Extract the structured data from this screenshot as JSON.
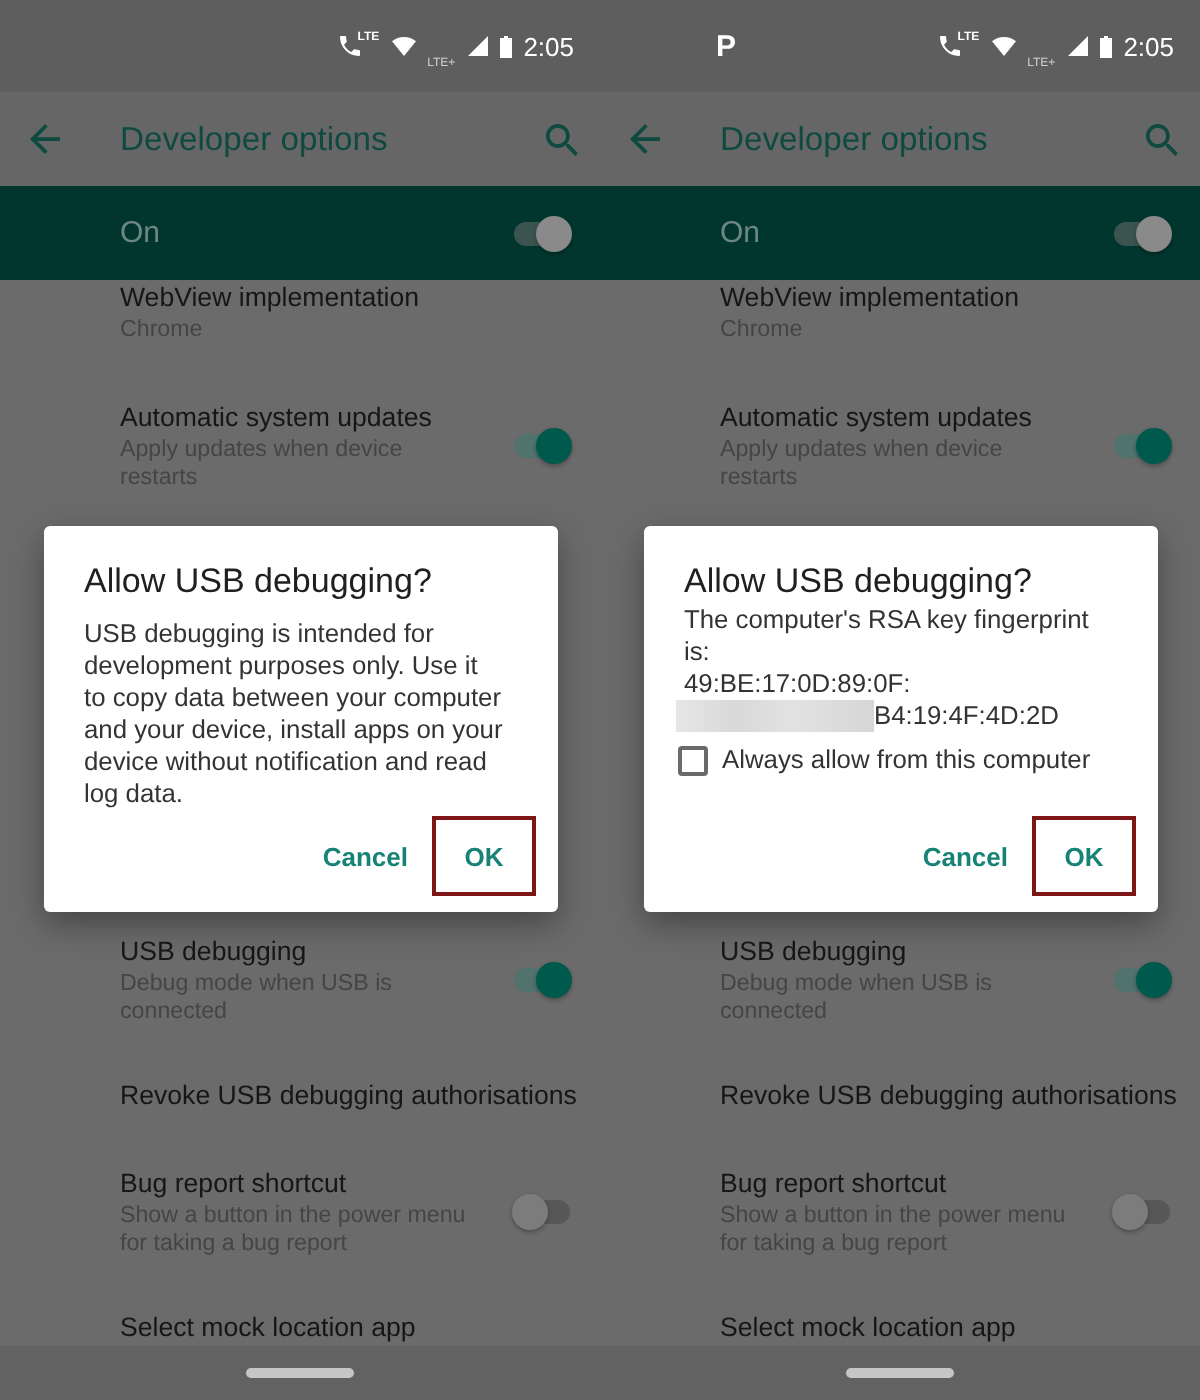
{
  "screens": [
    {
      "status_bar": {
        "volte_label": "LTE",
        "network_label": "LTE+",
        "time": "2:05"
      },
      "app_bar": {
        "title": "Developer options"
      },
      "master_switch": {
        "label": "On",
        "on": true
      },
      "settings_above": [
        {
          "kind": "text",
          "title": "WebView implementation",
          "summary": "Chrome"
        },
        {
          "kind": "switch",
          "title": "Automatic system updates",
          "summary": "Apply updates when device restarts",
          "on": true
        }
      ],
      "dialog": {
        "title": "Allow USB debugging?",
        "message": "USB debugging is intended for\ndevelopment purposes only. Use it\nto copy data between your computer\nand your device, install apps on your\ndevice without notification and read\nlog data.",
        "buttons": [
          {
            "label": "Cancel",
            "highlighted": false
          },
          {
            "label": "OK",
            "highlighted": true
          }
        ]
      },
      "settings_below": [
        {
          "kind": "switch",
          "title": "USB debugging",
          "summary": "Debug mode when USB is connected",
          "on": true
        },
        {
          "kind": "text",
          "title": "Revoke USB debugging authorisations"
        },
        {
          "kind": "switch",
          "title": "Bug report shortcut",
          "summary": "Show a button in the power menu for taking a bug report",
          "on": false
        },
        {
          "kind": "text",
          "title": "Select mock location app"
        }
      ]
    },
    {
      "status_bar": {
        "notification_icons": [
          "P"
        ],
        "volte_label": "LTE",
        "network_label": "LTE+",
        "time": "2:05"
      },
      "app_bar": {
        "title": "Developer options"
      },
      "master_switch": {
        "label": "On",
        "on": true
      },
      "settings_above": [
        {
          "kind": "text",
          "title": "WebView implementation",
          "summary": "Chrome"
        },
        {
          "kind": "switch",
          "title": "Automatic system updates",
          "summary": "Apply updates when device restarts",
          "on": true
        }
      ],
      "dialog": {
        "title": "Allow USB debugging?",
        "message": "The computer's RSA key fingerprint\nis:",
        "fingerprint": [
          {
            "text": "49:BE:17:0D:89:0F:",
            "redacted": false
          },
          {
            "text": "B4:19:4F:4D:2D",
            "redacted": true
          }
        ],
        "checkbox": {
          "label": "Always allow from this computer",
          "checked": false
        },
        "buttons": [
          {
            "label": "Cancel",
            "highlighted": false
          },
          {
            "label": "OK",
            "highlighted": true
          }
        ]
      },
      "settings_below": [
        {
          "kind": "switch",
          "title": "USB debugging",
          "summary": "Debug mode when USB is connected",
          "on": true
        },
        {
          "kind": "text",
          "title": "Revoke USB debugging authorisations"
        },
        {
          "kind": "switch",
          "title": "Bug report shortcut",
          "summary": "Show a button in the power menu for taking a bug report",
          "on": false
        },
        {
          "kind": "text",
          "title": "Select mock location app"
        }
      ]
    }
  ]
}
